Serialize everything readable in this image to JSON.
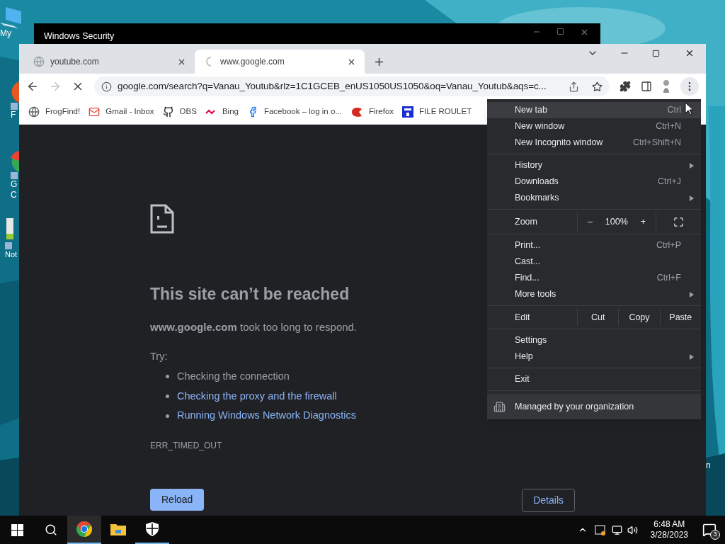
{
  "desktop_icons": [
    {
      "lines": [
        "My"
      ]
    },
    {
      "lines": [
        "F"
      ]
    },
    {
      "lines": [
        "G",
        "C"
      ]
    },
    {
      "lines": [
        "Not"
      ]
    },
    {
      "lines": [
        "n"
      ]
    }
  ],
  "security_window": {
    "title": "Windows Security",
    "active": false
  },
  "browser": {
    "tabs": [
      {
        "title": "youtube.com",
        "selected": false,
        "loading": false
      },
      {
        "title": "www.google.com",
        "selected": true,
        "loading": true
      }
    ],
    "toolbar": {
      "forward_disabled": true,
      "loading": true,
      "url": "google.com/search?q=Vanau_Youtub&rlz=1C1GCEB_enUS1050US1050&oq=Vanau_Youtub&aqs=c..."
    },
    "bookmarks": [
      {
        "label": "FrogFind!"
      },
      {
        "label": "Gmail - Inbox"
      },
      {
        "label": "OBS"
      },
      {
        "label": "Bing"
      },
      {
        "label": "Facebook – log in o..."
      },
      {
        "label": "Firefox"
      },
      {
        "label": "FILE ROULET"
      }
    ],
    "page": {
      "title": "This site can’t be reached",
      "description": "**www.google.com** took too long to respond.",
      "try_label": "Try:",
      "suggestions": [
        {
          "kind": "text",
          "text": "Checking the connection"
        },
        {
          "kind": "link",
          "text": "Checking the proxy and the firewall"
        },
        {
          "kind": "link",
          "text": "Running Windows Network Diagnostics"
        }
      ],
      "error_code": "ERR_TIMED_OUT",
      "reload_button": "Reload",
      "details_button": "Details"
    },
    "menu": [
      {
        "kind": "item",
        "label": "New tab",
        "shortcut": "Ctrl",
        "submenu": false,
        "selected": true
      },
      {
        "kind": "item",
        "label": "New window",
        "shortcut": "Ctrl+N",
        "submenu": false,
        "selected": false
      },
      {
        "kind": "item",
        "label": "New Incognito window",
        "shortcut": "Ctrl+Shift+N",
        "submenu": false,
        "selected": false
      },
      {
        "kind": "separator"
      },
      {
        "kind": "item",
        "label": "History",
        "submenu": true,
        "selected": false
      },
      {
        "kind": "item",
        "label": "Downloads",
        "shortcut": "Ctrl+J",
        "submenu": false,
        "selected": false
      },
      {
        "kind": "item",
        "label": "Bookmarks",
        "submenu": true,
        "selected": false
      },
      {
        "kind": "separator"
      },
      {
        "kind": "zoom",
        "label": "Zoom",
        "minus": "–",
        "value": "100%",
        "plus": "+"
      },
      {
        "kind": "separator"
      },
      {
        "kind": "item",
        "label": "Print...",
        "shortcut": "Ctrl+P",
        "submenu": false,
        "selected": false
      },
      {
        "kind": "item",
        "label": "Cast...",
        "submenu": false,
        "selected": false
      },
      {
        "kind": "item",
        "label": "Find...",
        "shortcut": "Ctrl+F",
        "submenu": false,
        "selected": false
      },
      {
        "kind": "item",
        "label": "More tools",
        "submenu": true,
        "selected": false
      },
      {
        "kind": "separator"
      },
      {
        "kind": "edit",
        "label": "Edit",
        "actions": [
          "Cut",
          "Copy",
          "Paste"
        ]
      },
      {
        "kind": "separator"
      },
      {
        "kind": "item",
        "label": "Settings",
        "submenu": false,
        "selected": false
      },
      {
        "kind": "item",
        "label": "Help",
        "submenu": true,
        "selected": false
      },
      {
        "kind": "separator"
      },
      {
        "kind": "item",
        "label": "Exit",
        "submenu": false,
        "selected": false
      },
      {
        "kind": "separator"
      },
      {
        "kind": "managed",
        "label": "Managed by your organization"
      }
    ]
  },
  "taskbar": {
    "apps": [
      {
        "active": true,
        "running": true
      },
      {
        "active": false,
        "running": false
      },
      {
        "active": false,
        "running": true
      }
    ],
    "time": "6:48 AM",
    "date": "3/28/2023",
    "notifications": "3"
  }
}
